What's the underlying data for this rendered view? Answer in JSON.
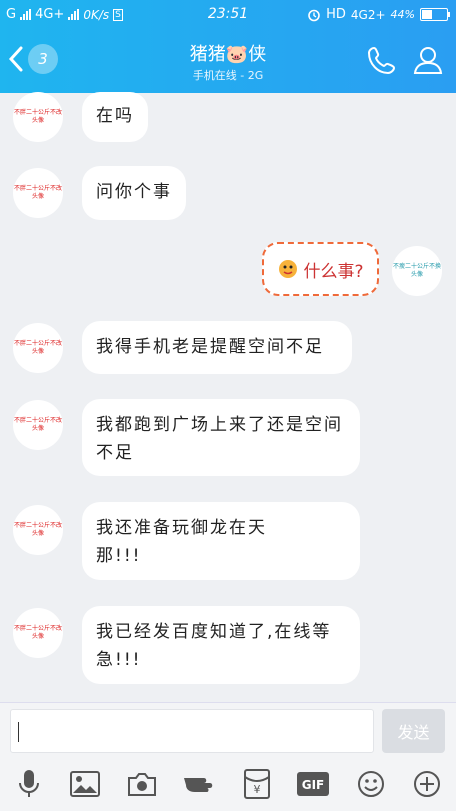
{
  "status_bar": {
    "carrier1": "G",
    "carrier2": "4G+",
    "speed": "0K/s",
    "sim_badge": "S",
    "time": "23:51",
    "hd": "HD",
    "network": "4G2+",
    "battery": "44%",
    "battery_level": 0.44
  },
  "header": {
    "back_badge": "3",
    "title": "猪猪🐷侠",
    "subtitle": "手机在线 - 2G"
  },
  "avatars": {
    "contact_text": "不胖二十公斤不改头像",
    "self_text": "不瘦二十公斤不换头像"
  },
  "messages": [
    {
      "side": "left",
      "text": "在吗"
    },
    {
      "side": "left",
      "text": "问你个事"
    },
    {
      "side": "right",
      "text": "什么事?"
    },
    {
      "side": "left",
      "text": "我得手机老是提醒空间不足"
    },
    {
      "side": "left",
      "text": "我都跑到广场上来了还是空间不足"
    },
    {
      "side": "left",
      "text": "我还准备玩御龙在天那!!!"
    },
    {
      "side": "left",
      "text": "我已经发百度知道了,在线等急!!!"
    }
  ],
  "input": {
    "value": "",
    "send_label": "发送"
  },
  "toolbar": [
    "mic-icon",
    "image-icon",
    "camera-icon",
    "hand-icon",
    "red-packet-icon",
    "gif-icon",
    "emoji-icon",
    "plus-icon"
  ],
  "colors": {
    "header": "#2aa8f0",
    "accent_orange": "#ef6a3a"
  }
}
